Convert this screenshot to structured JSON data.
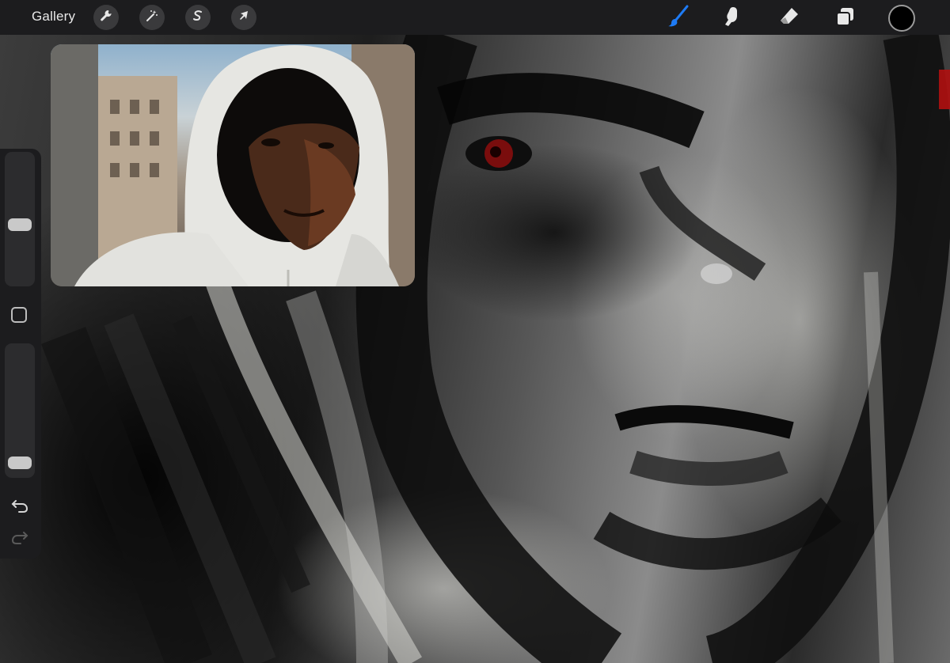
{
  "toolbar": {
    "gallery_label": "Gallery",
    "left_tools": [
      {
        "name": "actions",
        "icon": "wrench-icon"
      },
      {
        "name": "adjustments",
        "icon": "magic-wand-icon"
      },
      {
        "name": "selection",
        "icon": "selection-s-icon"
      },
      {
        "name": "transform",
        "icon": "arrow-cursor-icon"
      }
    ],
    "right_tools": [
      {
        "name": "brush",
        "icon": "brush-icon",
        "active": true
      },
      {
        "name": "smudge",
        "icon": "smudge-finger-icon"
      },
      {
        "name": "eraser",
        "icon": "eraser-icon"
      },
      {
        "name": "layers",
        "icon": "layers-icon"
      }
    ],
    "color_well": "#000000",
    "active_color": "#1e7bf5"
  },
  "sidebar": {
    "brush_size_level": 0.45,
    "opacity_level": 0.05,
    "modify_icon": "square-icon",
    "undo_icon": "undo-arrow-icon",
    "redo_icon": "redo-arrow-icon"
  },
  "reference": {
    "icon": "reference-photo"
  }
}
